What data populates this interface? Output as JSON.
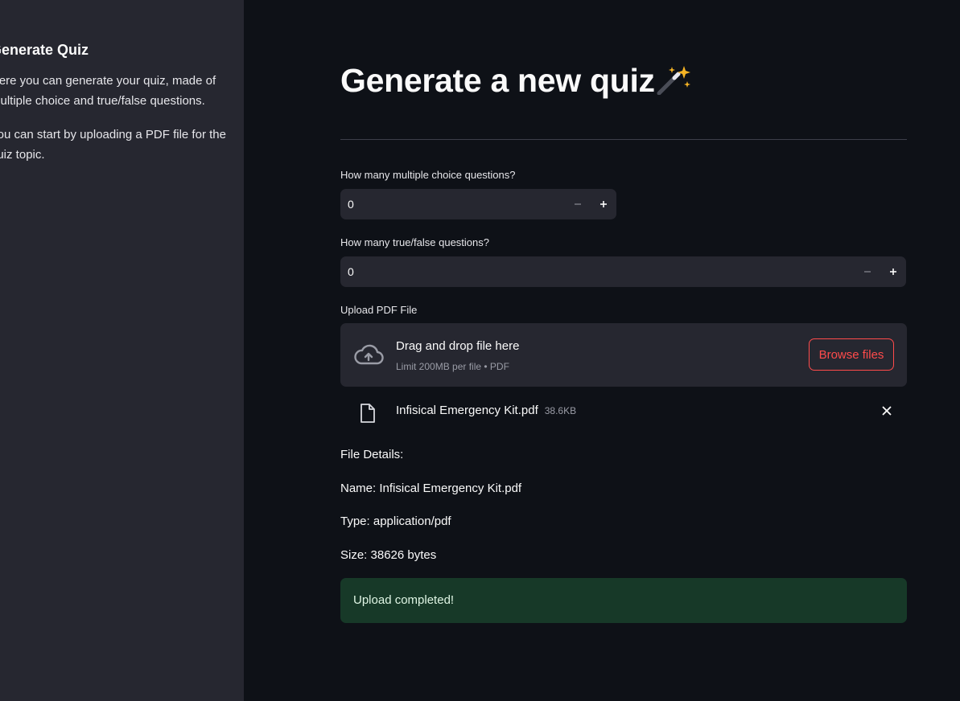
{
  "sidebar": {
    "title": "Generate Quiz",
    "paragraphs": [
      "Here you can generate your quiz, made of multiple choice and true/false questions.",
      "You can start by uploading a PDF file for the quiz topic."
    ]
  },
  "main": {
    "title": "Generate a new quiz",
    "title_icon": "magic-wand-emoji",
    "mc_questions": {
      "label": "How many multiple choice questions?",
      "value": "0"
    },
    "tf_questions": {
      "label": "How many true/false questions?",
      "value": "0"
    },
    "upload": {
      "label": "Upload PDF File",
      "drop_text": "Drag and drop file here",
      "limit_text": "Limit 200MB per file • PDF",
      "browse_label": "Browse files",
      "file_name": "Infisical Emergency Kit.pdf",
      "file_size": "38.6KB"
    },
    "details": {
      "heading": "File Details:",
      "name": "Name: Infisical Emergency Kit.pdf",
      "type": "Type: application/pdf",
      "size": "Size: 38626 bytes"
    },
    "success_message": "Upload completed!"
  },
  "colors": {
    "background": "#0e1117",
    "sidebar": "#262730",
    "accent": "#ff4b4b",
    "success_bg": "#173928"
  }
}
